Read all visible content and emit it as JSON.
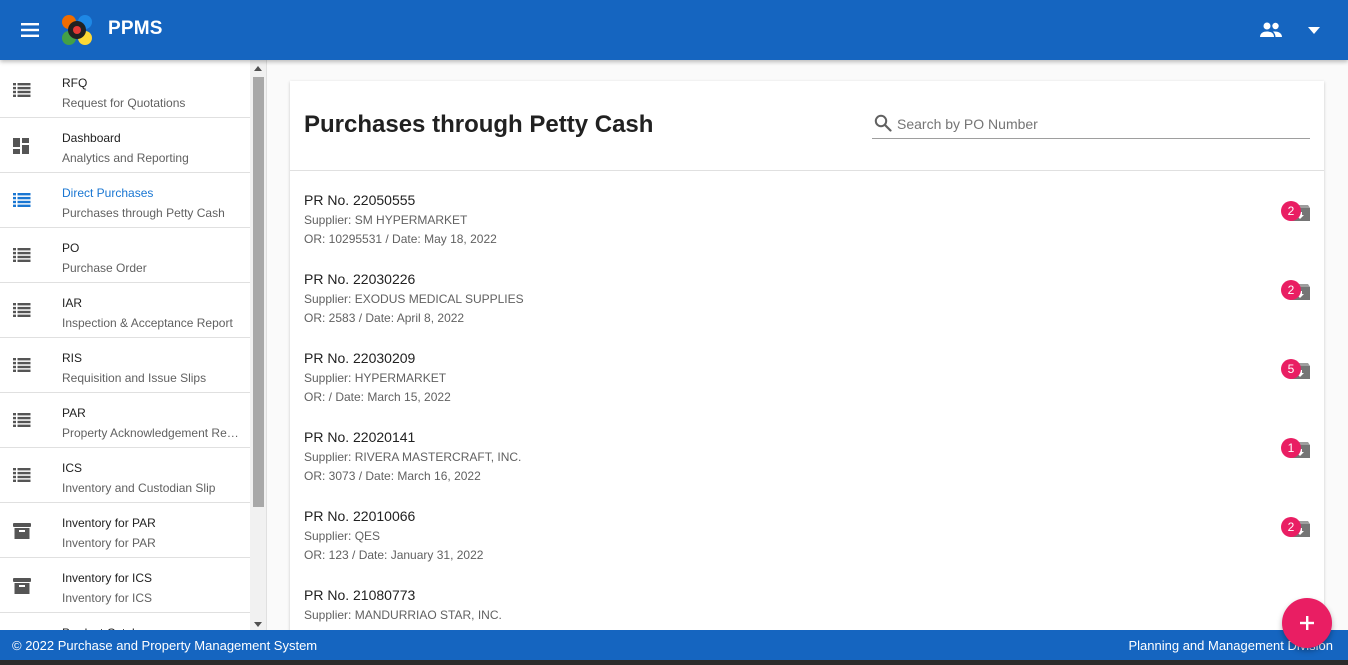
{
  "app": {
    "title": "PPMS"
  },
  "sidebar": {
    "items": [
      {
        "title": "RFQ",
        "subtitle": "Request for Quotations",
        "icon": "list-icon",
        "active": false
      },
      {
        "title": "Dashboard",
        "subtitle": "Analytics and Reporting",
        "icon": "dashboard-icon",
        "active": false
      },
      {
        "title": "Direct Purchases",
        "subtitle": "Purchases through Petty Cash",
        "icon": "list-icon",
        "active": true
      },
      {
        "title": "PO",
        "subtitle": "Purchase Order",
        "icon": "list-icon",
        "active": false
      },
      {
        "title": "IAR",
        "subtitle": "Inspection & Acceptance Report",
        "icon": "list-icon",
        "active": false
      },
      {
        "title": "RIS",
        "subtitle": "Requisition and Issue Slips",
        "icon": "list-icon",
        "active": false
      },
      {
        "title": "PAR",
        "subtitle": "Property Acknowledgement Receipt",
        "icon": "list-icon",
        "active": false
      },
      {
        "title": "ICS",
        "subtitle": "Inventory and Custodian Slip",
        "icon": "list-icon",
        "active": false
      },
      {
        "title": "Inventory for PAR",
        "subtitle": "Inventory for PAR",
        "icon": "archive-icon",
        "active": false
      },
      {
        "title": "Inventory for ICS",
        "subtitle": "Inventory for ICS",
        "icon": "archive-icon",
        "active": false
      },
      {
        "title": "Product Catalog",
        "subtitle": "",
        "icon": "list-icon",
        "active": false
      }
    ]
  },
  "main": {
    "title": "Purchases through Petty Cash",
    "search": {
      "placeholder": "Search by PO Number",
      "value": ""
    },
    "purchases": [
      {
        "pr": "PR No. 22050555",
        "supplier": "Supplier: SM HYPERMARKET",
        "or": "OR: 10295531 / Date: May 18, 2022",
        "badge": "2"
      },
      {
        "pr": "PR No. 22030226",
        "supplier": "Supplier: EXODUS MEDICAL SUPPLIES",
        "or": "OR: 2583 / Date: April 8, 2022",
        "badge": "2"
      },
      {
        "pr": "PR No. 22030209",
        "supplier": "Supplier: HYPERMARKET",
        "or": "OR: / Date: March 15, 2022",
        "badge": "5"
      },
      {
        "pr": "PR No. 22020141",
        "supplier": "Supplier: RIVERA MASTERCRAFT, INC.",
        "or": "OR: 3073 / Date: March 16, 2022",
        "badge": "1"
      },
      {
        "pr": "PR No. 22010066",
        "supplier": "Supplier: QES",
        "or": "OR: 123 / Date: January 31, 2022",
        "badge": "2"
      },
      {
        "pr": "PR No. 21080773",
        "supplier": "Supplier: MANDURRIAO STAR, INC.",
        "or": "",
        "badge": ""
      }
    ]
  },
  "footer": {
    "left": "© 2022 Purchase and Property Management System",
    "right": "Planning and Management Division"
  },
  "colors": {
    "primary": "#1565c0",
    "accent": "#e91e63",
    "active_nav": "#1976d2"
  }
}
